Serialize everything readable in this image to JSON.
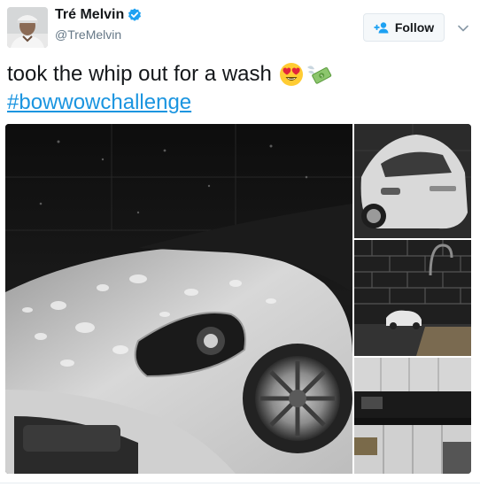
{
  "user": {
    "display_name": "Tré Melvin",
    "handle": "@TreMelvin",
    "verified": true,
    "avatar_icon": "user-avatar-photo"
  },
  "follow_button": {
    "label": "Follow",
    "icon": "add-user-icon"
  },
  "menu": {
    "icon": "chevron-down-icon"
  },
  "tweet": {
    "text": "took the whip out for a wash",
    "emojis": [
      "heart-eyes-emoji",
      "money-with-wings-emoji"
    ],
    "hashtag": "#bowwowchallenge"
  },
  "media": {
    "count": 4,
    "items": [
      {
        "icon": "car-headlight-closeup-photo"
      },
      {
        "icon": "car-rear-photo"
      },
      {
        "icon": "toy-car-in-sink-photo"
      },
      {
        "icon": "kitchen-photo"
      }
    ]
  },
  "colors": {
    "link": "#1b95e0",
    "verified": "#1da1f2",
    "secondary_text": "#657786",
    "button_bg": "#f5f8fa"
  }
}
